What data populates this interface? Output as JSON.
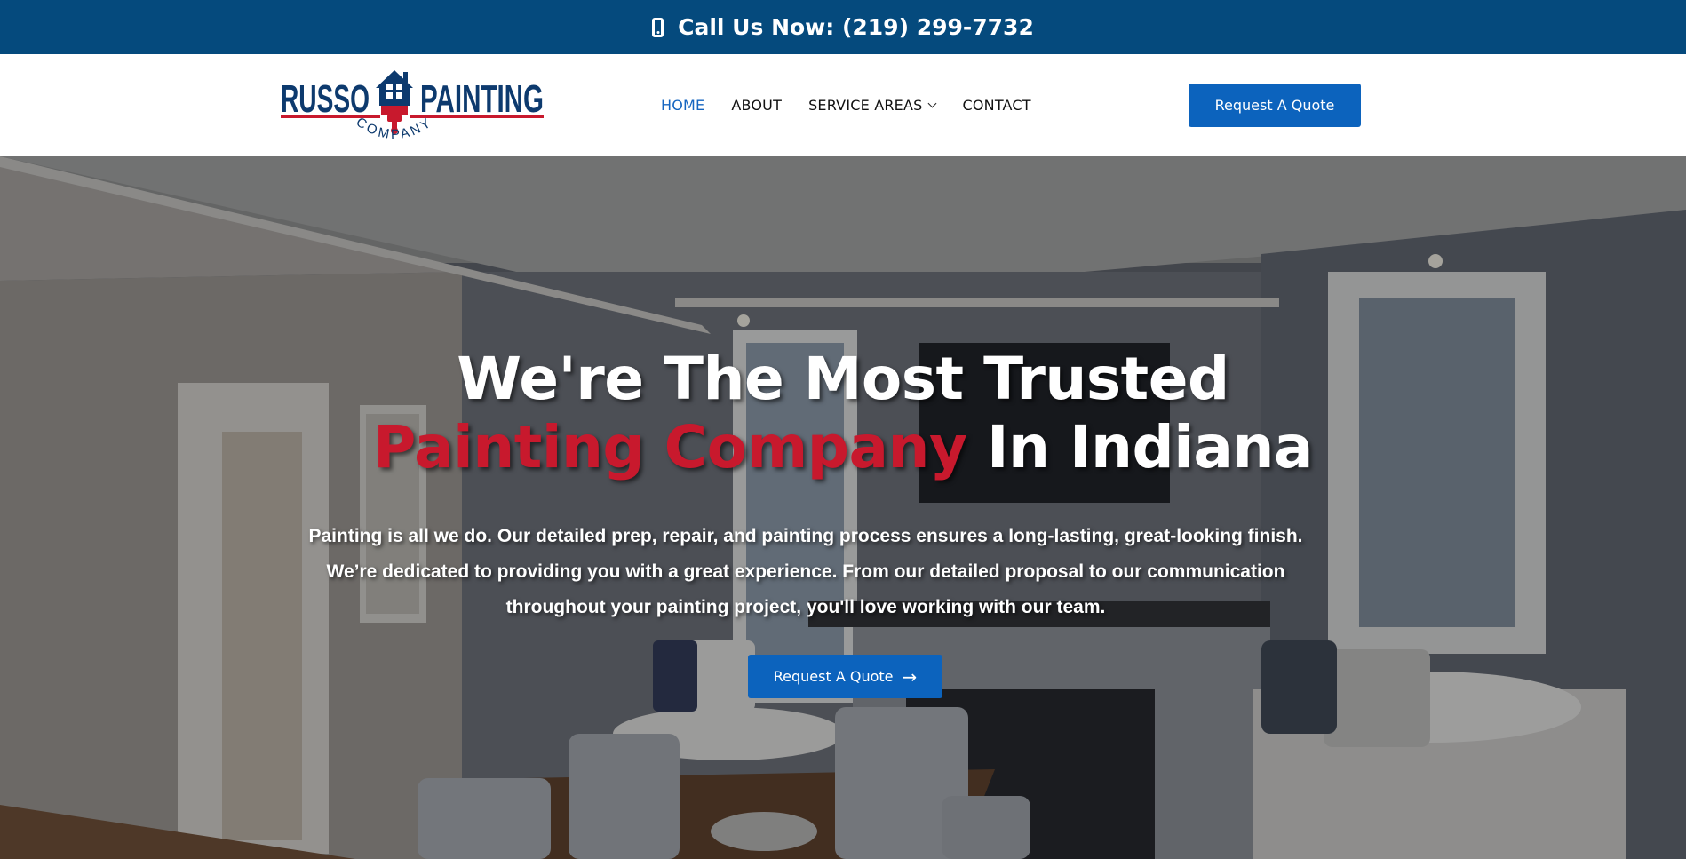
{
  "topbar": {
    "call_text": "Call Us Now: (219) 299-7732",
    "icon": "phone-icon"
  },
  "logo": {
    "word_left": "RUSSO",
    "word_right": "PAINTING",
    "word_bottom": "COMPANY"
  },
  "nav": {
    "items": [
      {
        "label": "HOME",
        "active": true
      },
      {
        "label": "ABOUT",
        "active": false
      },
      {
        "label": "SERVICE AREAS",
        "active": false,
        "dropdown": true
      },
      {
        "label": "CONTACT",
        "active": false
      }
    ]
  },
  "header": {
    "quote_button": "Request A Quote"
  },
  "hero": {
    "title_line1": "We're The Most Trusted",
    "title_red": "Painting Company",
    "title_rest": " In Indiana",
    "description": "Painting is all we do. Our detailed prep, repair, and painting process ensures a long-lasting, great-looking finish. We’re dedicated to providing you with a great experience. From our detailed proposal to our communication throughout your painting project, you'll love working with our team.",
    "button_label": "Request A Quote",
    "button_icon": "arrow-right-icon"
  },
  "colors": {
    "topbar": "#054a7d",
    "accent_blue": "#0c63bd",
    "brand_red": "#c8192d",
    "nav_active": "#1565c0"
  }
}
